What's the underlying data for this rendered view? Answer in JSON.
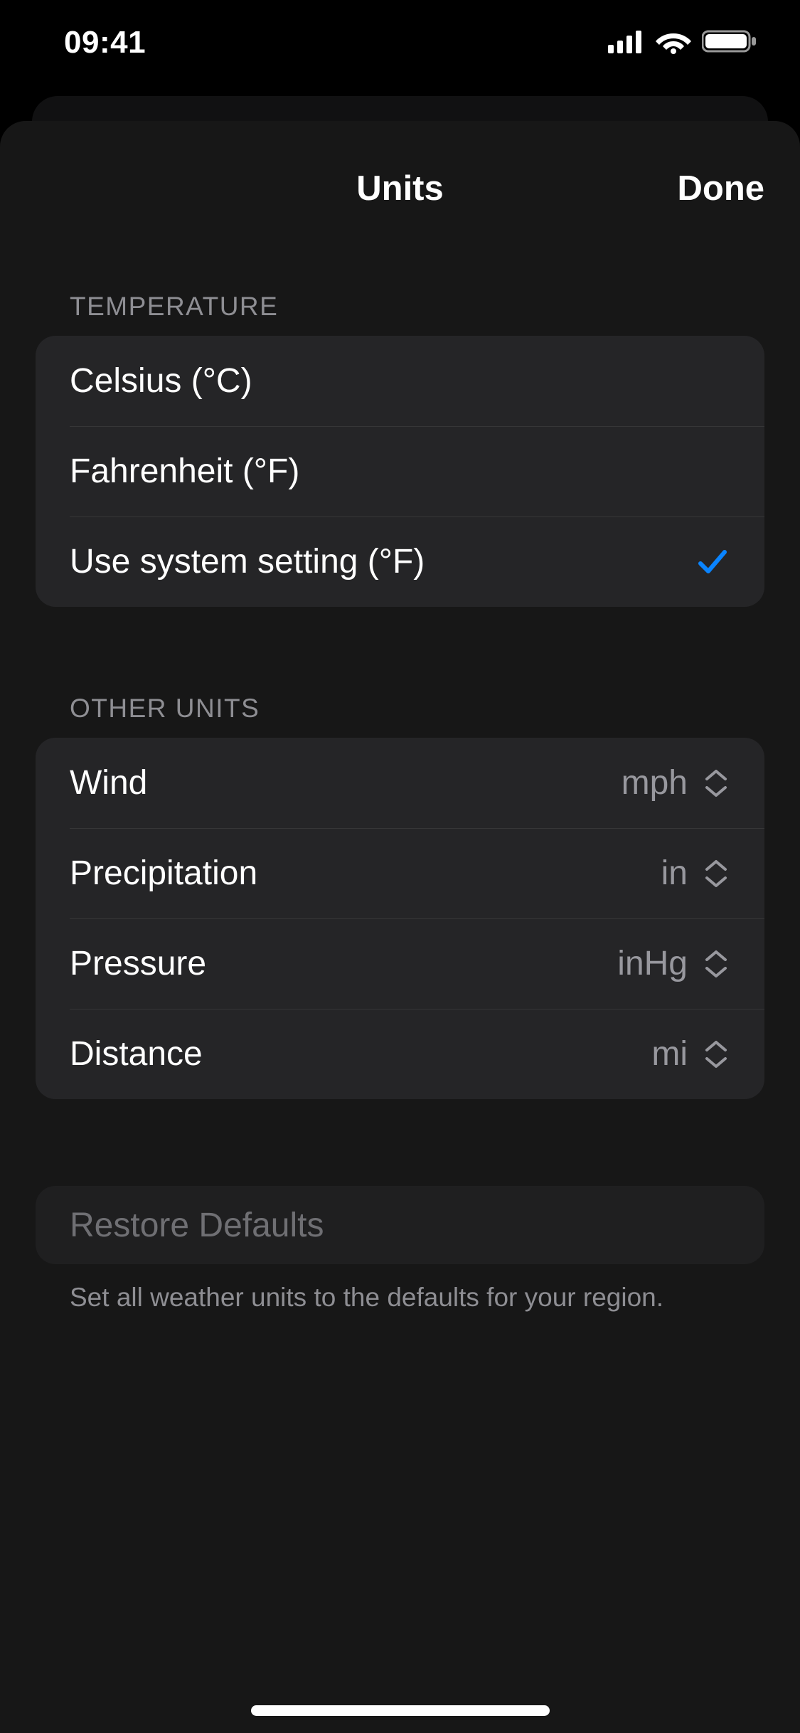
{
  "status": {
    "time": "09:41"
  },
  "nav": {
    "title": "Units",
    "done": "Done"
  },
  "sections": {
    "temperature": {
      "header": "TEMPERATURE",
      "rows": {
        "celsius": "Celsius (°C)",
        "fahrenheit": "Fahrenheit (°F)",
        "system": "Use system setting (°F)"
      },
      "selected": "system"
    },
    "other": {
      "header": "OTHER UNITS",
      "wind": {
        "label": "Wind",
        "value": "mph"
      },
      "precipitation": {
        "label": "Precipitation",
        "value": "in"
      },
      "pressure": {
        "label": "Pressure",
        "value": "inHg"
      },
      "distance": {
        "label": "Distance",
        "value": "mi"
      }
    },
    "restore": {
      "label": "Restore Defaults",
      "footer": "Set all weather units to the defaults for your region."
    }
  }
}
